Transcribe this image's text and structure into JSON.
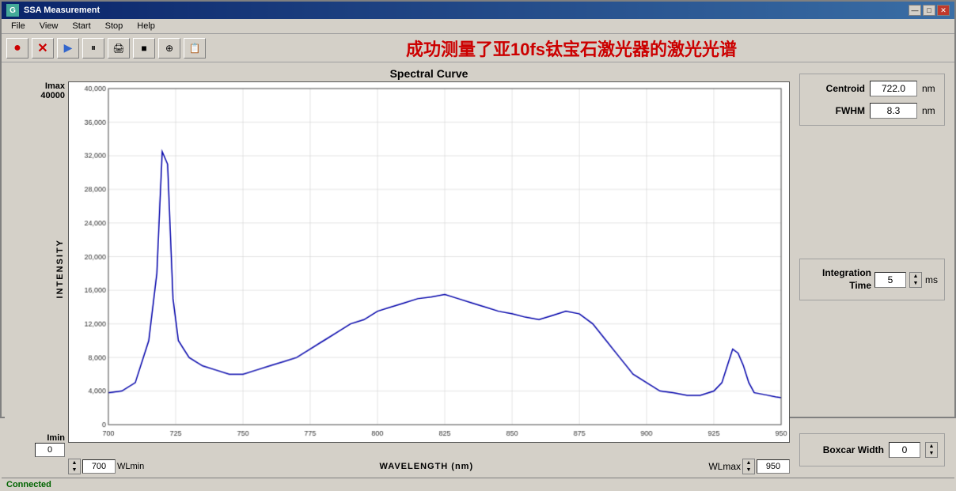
{
  "window": {
    "title": "SSA Measurement",
    "icon": "G"
  },
  "titleControls": {
    "minimize": "—",
    "maximize": "□",
    "close": "✕"
  },
  "menu": {
    "items": [
      "File",
      "View",
      "Start",
      "Stop",
      "Help"
    ]
  },
  "toolbar": {
    "title": "成功测量了亚10fs钛宝石激光器的激光光谱",
    "buttons": [
      "●",
      "✕",
      "▶",
      "⏸",
      "🖨",
      "■",
      "🖱",
      "📋"
    ]
  },
  "chart": {
    "title": "Spectral Curve",
    "imax_label": "Imax",
    "imax_value": "40000",
    "imin_label": "Imin",
    "imin_value": "0",
    "intensity_label": "INTENSITY",
    "wavelength_label": "WAVELENGTH (nm)",
    "wlmin_label": "WLmin",
    "wlmin_value": "700",
    "wlmax_label": "WLmax",
    "wlmax_value": "950",
    "y_ticks": [
      "40,000",
      "36,000",
      "32,000",
      "28,000",
      "24,000",
      "20,000",
      "16,000",
      "12,000",
      "8,000",
      "4,000",
      "0"
    ],
    "x_ticks": [
      "700",
      "725",
      "750",
      "775",
      "800",
      "825",
      "850",
      "875",
      "900",
      "925",
      "950"
    ]
  },
  "rightPanel": {
    "centroid_label": "Centroid",
    "centroid_value": "722.0",
    "centroid_unit": "nm",
    "fwhm_label": "FWHM",
    "fwhm_value": "8.3",
    "fwhm_unit": "nm",
    "integration_label": "Integration\nTime",
    "integration_value": "5",
    "integration_unit": "ms",
    "boxcar_label": "Boxcar Width",
    "boxcar_value": "0"
  },
  "statusBar": {
    "text": "Connected"
  }
}
